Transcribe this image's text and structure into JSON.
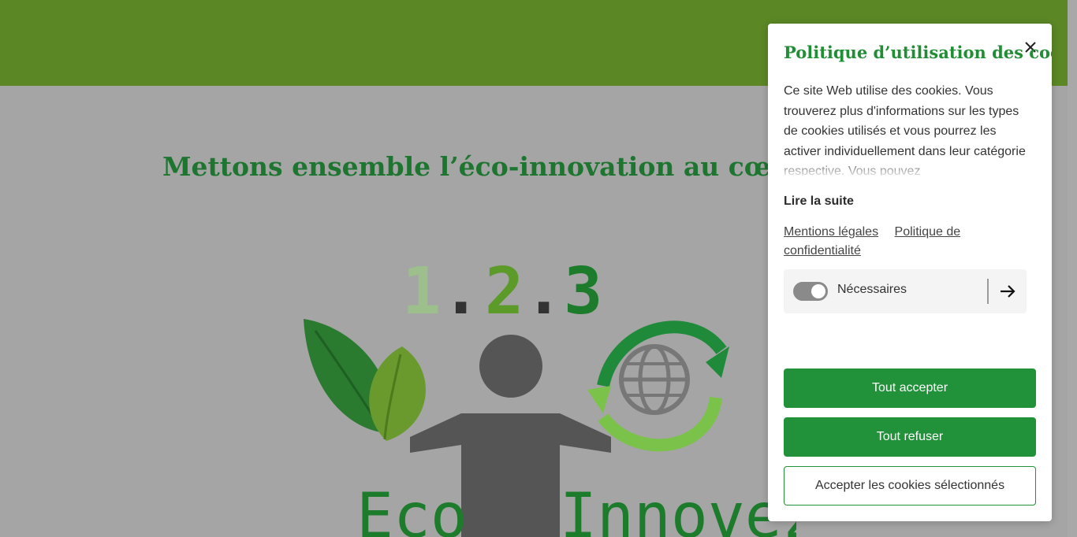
{
  "colors": {
    "header_bar": "#5b8725",
    "brand_green": "#21913a",
    "overlay_background": "#a5a5a5"
  },
  "page": {
    "headline": "Mettons ensemble l’éco-innovation au cœur de v",
    "logo": {
      "digits": [
        "1",
        "2",
        "3"
      ],
      "separators": [
        ".",
        "."
      ],
      "word_left": "Eco",
      "word_right": "Innovez"
    }
  },
  "cookie_modal": {
    "title": "Politique d’utilisation des cookies",
    "close_icon": "close-icon",
    "description": "Ce site Web utilise des cookies. Vous trouverez plus d'informations sur les types de cookies utilisés et vous pourrez les activer individuellement dans leur catégorie respective. Vous pouvez",
    "read_more": "Lire la suite",
    "links": {
      "legal": "Mentions légales",
      "privacy": "Politique de confidentialité"
    },
    "category": {
      "label": "Nécessaires",
      "toggle_on": true,
      "arrow_icon": "arrow-right-icon"
    },
    "buttons": {
      "accept_all": "Tout accepter",
      "reject_all": "Tout refuser",
      "accept_selected": "Accepter les cookies sélectionnés"
    }
  }
}
